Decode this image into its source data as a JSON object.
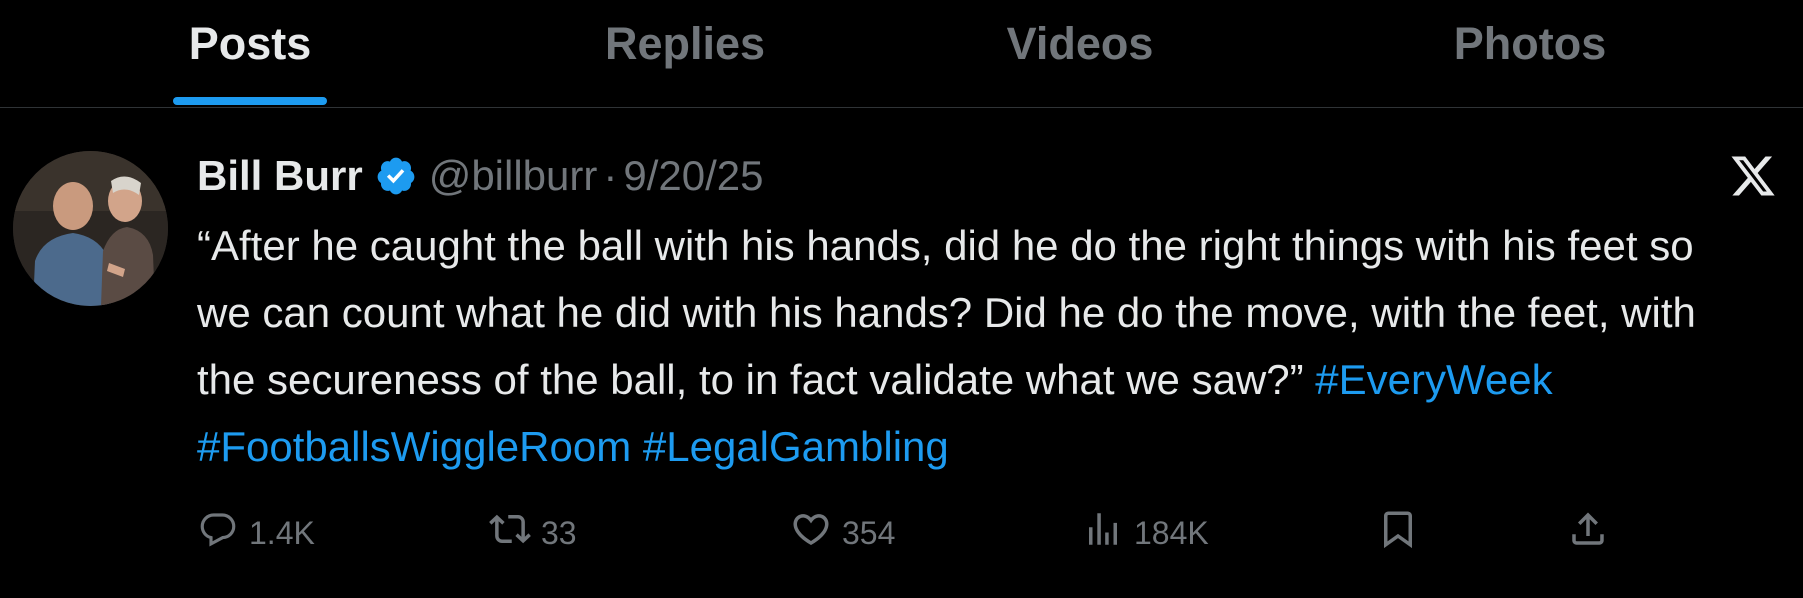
{
  "tabs": [
    {
      "label": "Posts",
      "active": true
    },
    {
      "label": "Replies",
      "active": false
    },
    {
      "label": "Videos",
      "active": false
    },
    {
      "label": "Photos",
      "active": false
    }
  ],
  "tweet": {
    "author_name": "Bill Burr",
    "handle": "@billburr",
    "separator": "·",
    "date": "9/20/25",
    "text": "“After he caught the ball with his hands, did he do the right things with his feet so we can count what he did with his hands? Did he do the move, with the feet, with the secureness of the ball, to in fact validate what we saw?”",
    "hashtags": [
      "#EveryWeek",
      "#FootballsWiggleRoom",
      "#LegalGambling"
    ],
    "stats": {
      "replies": "1.4K",
      "reposts": "33",
      "likes": "354",
      "views": "184K"
    }
  },
  "icons": {
    "verified": "verified-badge-icon",
    "platform": "x-logo-icon",
    "reply": "reply-icon",
    "repost": "repost-icon",
    "like": "heart-icon",
    "views": "views-icon",
    "bookmark": "bookmark-icon",
    "share": "share-icon"
  },
  "colors": {
    "background": "#000000",
    "text": "#e7e9ea",
    "secondary": "#71767b",
    "accent": "#1d9bf0",
    "divider": "#2f3336"
  }
}
